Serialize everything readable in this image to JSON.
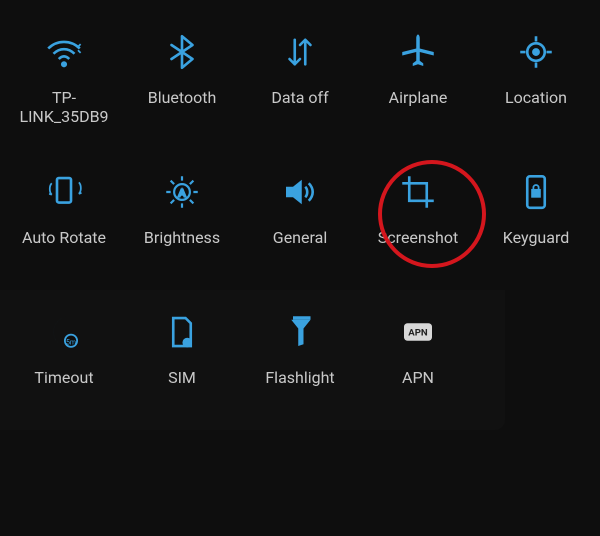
{
  "tiles": {
    "wifi": {
      "label": "TP-\nLINK_35DB9"
    },
    "bluetooth": {
      "label": "Bluetooth"
    },
    "data": {
      "label": "Data off"
    },
    "airplane": {
      "label": "Airplane"
    },
    "location": {
      "label": "Location"
    },
    "rotate": {
      "label": "Auto Rotate"
    },
    "brightness": {
      "label": "Brightness"
    },
    "sound": {
      "label": "General"
    },
    "screenshot": {
      "label": "Screenshot"
    },
    "keyguard": {
      "label": "Keyguard"
    },
    "timeout": {
      "label": "Timeout"
    },
    "sim": {
      "label": "SIM"
    },
    "flashlight": {
      "label": "Flashlight"
    },
    "apn": {
      "label": "APN"
    }
  },
  "apn_badge_text": "APN",
  "highlight": "screenshot",
  "accent_color": "#3aa2e0",
  "highlight_color": "#d4161d"
}
